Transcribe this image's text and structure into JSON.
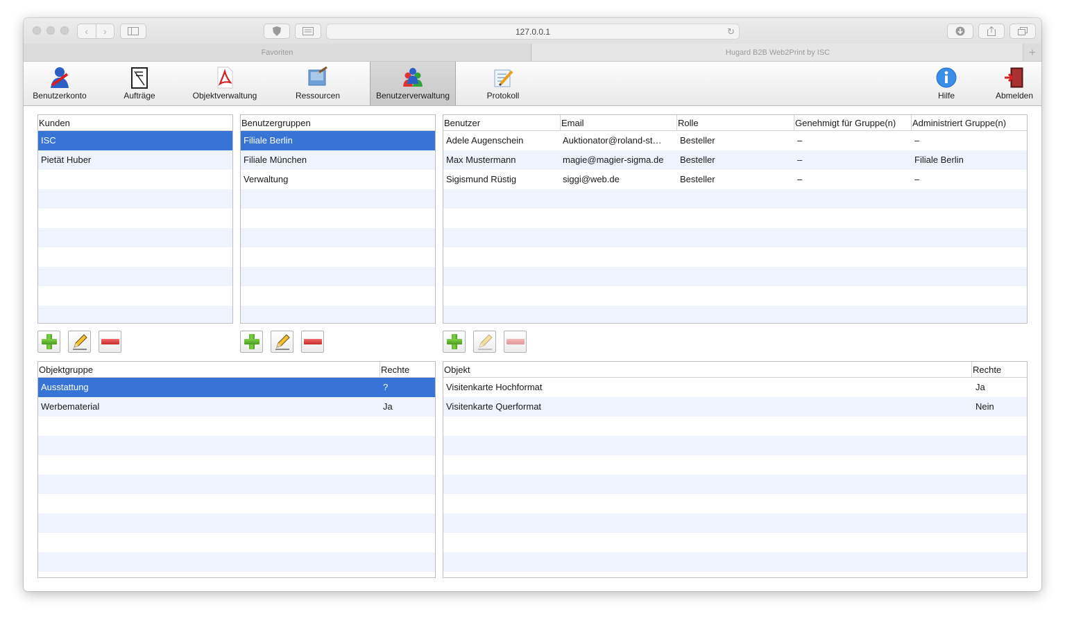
{
  "browser": {
    "url": "127.0.0.1",
    "tabs": [
      {
        "label": "Favoriten"
      },
      {
        "label": "Hugard B2B Web2Print by ISC"
      }
    ],
    "new_tab_label": "+"
  },
  "toolbar": {
    "items": [
      {
        "label": "Benutzerkonto",
        "icon": "user-account-icon"
      },
      {
        "label": "Aufträge",
        "icon": "orders-icon"
      },
      {
        "label": "Objektverwaltung",
        "icon": "pdf-icon"
      },
      {
        "label": "Ressourcen",
        "icon": "resources-icon"
      },
      {
        "label": "Benutzerverwaltung",
        "icon": "user-management-icon",
        "active": true
      },
      {
        "label": "Protokoll",
        "icon": "protocol-icon"
      },
      {
        "label": "Hilfe",
        "icon": "info-icon"
      },
      {
        "label": "Abmelden",
        "icon": "logout-icon"
      }
    ]
  },
  "kunden": {
    "header": "Kunden",
    "rows": [
      "ISC",
      "Pietät Huber"
    ],
    "selected": 0
  },
  "gruppen": {
    "header": "Benutzergruppen",
    "rows": [
      "Filiale Berlin",
      "Filiale München",
      "Verwaltung"
    ],
    "selected": 0
  },
  "benutzer": {
    "headers": [
      "Benutzer",
      "Email",
      "Rolle",
      "Genehmigt für Gruppe(n)",
      "Administriert Gruppe(n)"
    ],
    "rows": [
      [
        "Adele Augenschein",
        "Auktionator@roland-st…",
        "Besteller",
        "–",
        "–"
      ],
      [
        "Max Mustermann",
        "magie@magier-sigma.de",
        "Besteller",
        "–",
        "Filiale Berlin"
      ],
      [
        "Sigismund Rüstig",
        "siggi@web.de",
        "Besteller",
        "–",
        "–"
      ]
    ]
  },
  "objektgruppen": {
    "headers": [
      "Objektgruppe",
      "Rechte"
    ],
    "rows": [
      [
        "Ausstattung",
        "?"
      ],
      [
        "Werbematerial",
        "Ja"
      ]
    ],
    "selected": 0
  },
  "objekte": {
    "headers": [
      "Objekt",
      "Rechte"
    ],
    "rows": [
      [
        "Visitenkarte Hochformat",
        "Ja"
      ],
      [
        "Visitenkarte Querformat",
        "Nein"
      ]
    ]
  },
  "colors": {
    "selection": "#3874d6",
    "stripe": "#eef3fd",
    "add_green": "#5fb12f",
    "remove_red": "#d13a3a"
  }
}
